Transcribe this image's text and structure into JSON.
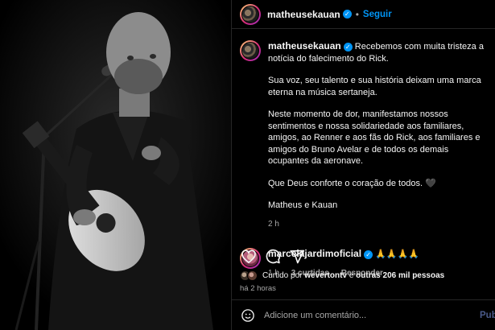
{
  "post": {
    "username": "matheusekauan",
    "follow_label": "Seguir",
    "separator": "•"
  },
  "caption": {
    "username": "matheusekauan",
    "paragraphs": [
      "Recebemos com muita tristeza a notícia do falecimento do Rick.",
      "Sua voz, seu talento e sua história deixam uma marca eterna na música sertaneja.",
      "Neste momento de dor, manifestamos nossos sentimentos e nossa solidariedade aos familiares, amigos, ao Renner e aos fãs do Rick, aos familiares e amigos do Bruno Avelar e de todos os demais ocupantes da aeronave.",
      "Que Deus conforte o coração de todos. 🖤",
      "Matheus e Kauan"
    ],
    "time": "2 h"
  },
  "comment": {
    "username": "marcelajardimoficial",
    "text": "🙏🙏🙏🙏",
    "time": "1 h",
    "likes": "3 curtidas",
    "reply_label": "Responder"
  },
  "likes": {
    "prefix": "Curtido por",
    "user": "wevertontv",
    "joiner": "e",
    "others": "outras 206 mil pessoas"
  },
  "timestamp": "há 2 horas",
  "add_comment": {
    "placeholder": "Adicione um comentário...",
    "post_label": "Publicar"
  },
  "colors": {
    "accent": "#0095f6",
    "background": "#000000",
    "muted": "#a8a8a8"
  },
  "icons": [
    "heart-icon",
    "comment-icon",
    "share-icon",
    "bookmark-icon",
    "emoji-icon",
    "verified-icon"
  ]
}
